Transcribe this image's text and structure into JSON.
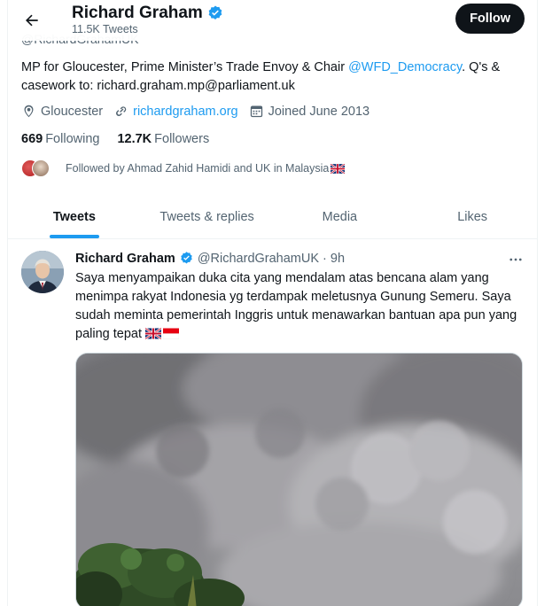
{
  "header": {
    "name": "Richard Graham",
    "tweet_count": "11.5K Tweets",
    "follow_label": "Follow",
    "handle_peek": "@RichardGrahamUK"
  },
  "profile": {
    "bio_before": "MP for Gloucester, Prime Minister’s Trade Envoy & Chair ",
    "bio_mention": "@WFD_Democracy",
    "bio_after": ". Q's & casework to: richard.graham.mp@parliament.uk",
    "location": "Gloucester",
    "website": "richardgraham.org",
    "joined": "Joined June 2013",
    "following_count": "669",
    "following_label": "Following",
    "followers_count": "12.7K",
    "followers_label": "Followers",
    "followed_by": "Followed by Ahmad Zahid Hamidi and UK in Malaysia"
  },
  "tabs": [
    {
      "label": "Tweets",
      "active": true
    },
    {
      "label": "Tweets & replies",
      "active": false
    },
    {
      "label": "Media",
      "active": false
    },
    {
      "label": "Likes",
      "active": false
    }
  ],
  "tweet": {
    "name": "Richard Graham",
    "handle": "@RichardGrahamUK",
    "dot": "·",
    "time": "9h",
    "text": "Saya menyampaikan duka cita yang mendalam atas bencana alam yang menimpa rakyat Indonesia yg terdampak meletusnya Gunung Semeru. Saya sudah meminta pemerintah Inggris untuk menawarkan bantuan apa pun yang paling tepat"
  },
  "colors": {
    "accent": "#1d9bf0",
    "text": "#0f1419",
    "muted": "#536471",
    "follow_bg": "#0f1419"
  },
  "icons": [
    "back-arrow-icon",
    "verified-badge-icon",
    "location-icon",
    "link-icon",
    "calendar-icon",
    "more-icon",
    "uk-flag-icon",
    "indonesia-flag-icon"
  ]
}
